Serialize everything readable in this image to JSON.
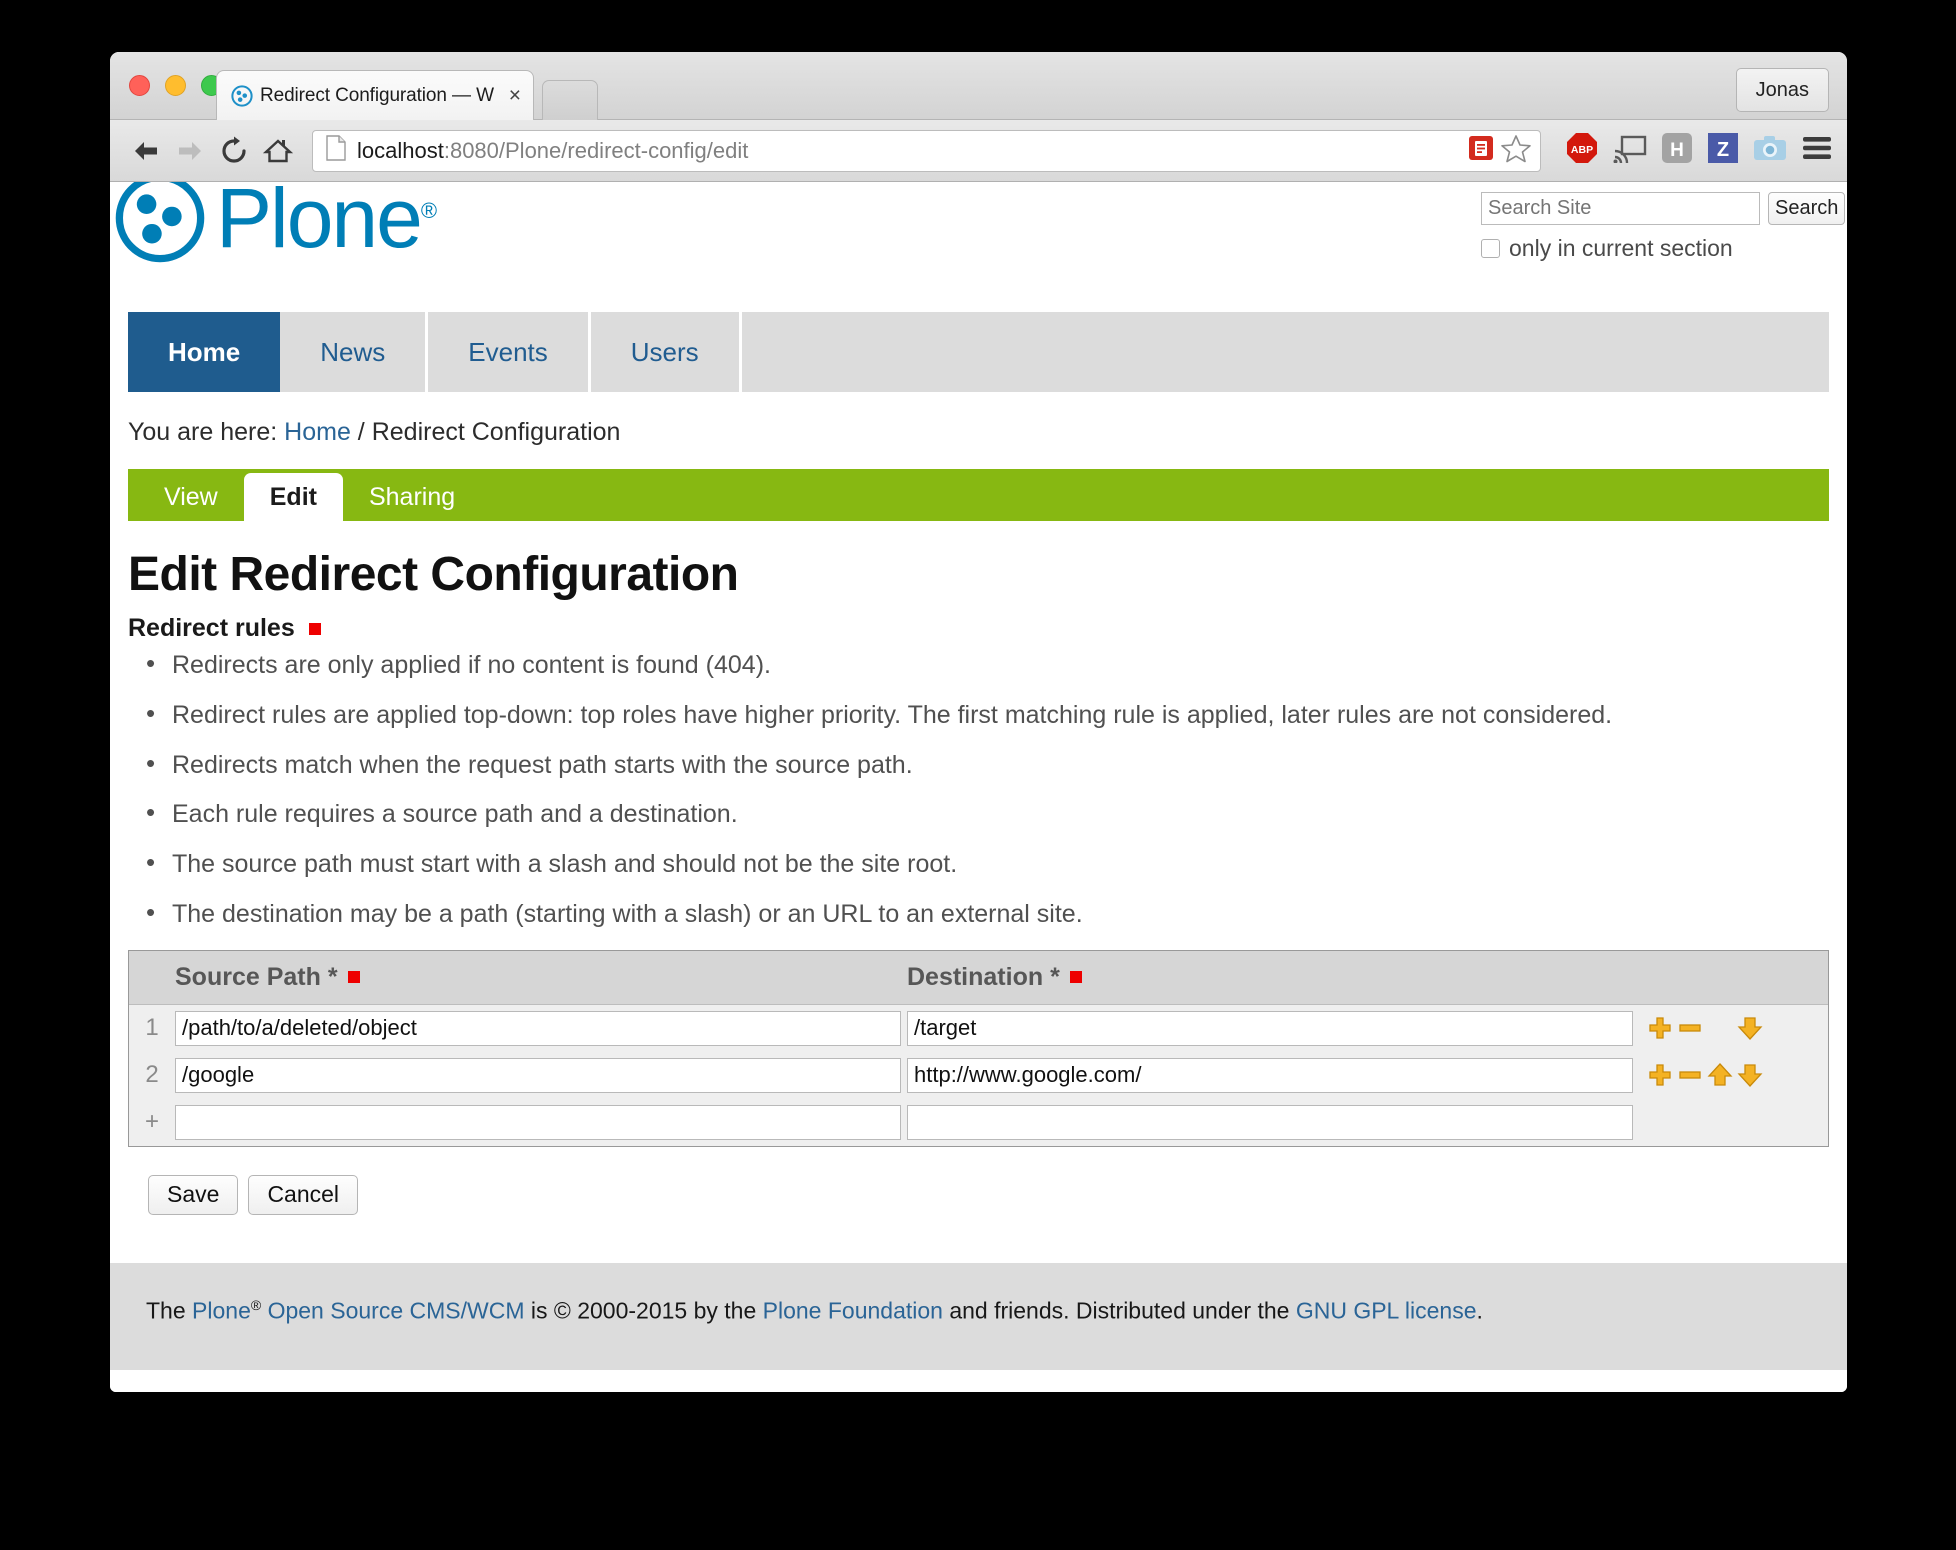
{
  "browser": {
    "tab": {
      "favicon": "plone-favicon",
      "title": "Redirect Configuration — W",
      "close_label": "×"
    },
    "profile_label": "Jonas",
    "url": {
      "host": "localhost",
      "rest": ":8080/Plone/redirect-config/edit",
      "full": "localhost:8080/Plone/redirect-config/edit"
    },
    "extensions": [
      "adblock-plus-icon",
      "cast-icon",
      "hypothesis-icon",
      "zotero-icon",
      "screenshot-camera-icon",
      "hamburger-menu-icon"
    ]
  },
  "site": {
    "logo_text": "Plone",
    "logo_reg": "®",
    "search": {
      "placeholder": "Search Site",
      "value": "",
      "button_label": "Search",
      "scope_label": "only in current section",
      "scope_checked": false
    },
    "nav": [
      {
        "label": "Home",
        "selected": true
      },
      {
        "label": "News",
        "selected": false
      },
      {
        "label": "Events",
        "selected": false
      },
      {
        "label": "Users",
        "selected": false
      }
    ],
    "breadcrumb": {
      "prefix": "You are here:",
      "home": "Home",
      "separator": "/",
      "current": "Redirect Configuration"
    },
    "content_tabs": [
      {
        "label": "View",
        "selected": false
      },
      {
        "label": "Edit",
        "selected": true
      },
      {
        "label": "Sharing",
        "selected": false
      }
    ]
  },
  "main": {
    "page_title": "Edit Redirect Configuration",
    "fieldset_label": "Redirect rules",
    "rules_help": [
      "Redirects are only applied if no content is found (404).",
      "Redirect rules are applied top-down: top roles have higher priority. The first matching rule is applied, later rules are not considered.",
      "Redirects match when the request path starts with the source path.",
      "Each rule requires a source path and a destination.",
      "The source path must start with a slash and should not be the site root.",
      "The destination may be a path (starting with a slash) or an URL to an external site."
    ],
    "datagrid": {
      "headers": [
        {
          "label": "Source Path *",
          "required": true
        },
        {
          "label": "Destination *",
          "required": true
        }
      ],
      "rows": [
        {
          "index": "1",
          "source": "/path/to/a/deleted/object",
          "destination": "/target",
          "actions": [
            "plus-icon",
            "minus-icon",
            "arrow-down-icon"
          ]
        },
        {
          "index": "2",
          "source": "/google",
          "destination": "http://www.google.com/",
          "actions": [
            "plus-icon",
            "minus-icon",
            "arrow-up-icon",
            "arrow-down-icon"
          ]
        },
        {
          "index": "+",
          "source": "",
          "destination": "",
          "actions": []
        }
      ]
    },
    "buttons": {
      "save": "Save",
      "cancel": "Cancel"
    }
  },
  "footer": {
    "t1": "The ",
    "link_plone": "Plone",
    "reg": "®",
    "link_oscms": " Open Source CMS/WCM",
    "t2": " is © 2000-2015 by the ",
    "link_foundation": "Plone Foundation",
    "t3": " and friends. Distributed under the ",
    "link_gnu": "GNU GPL license",
    "t4": "."
  },
  "colors": {
    "plone_blue": "#007EB6",
    "nav_selected": "#1F5C8E",
    "green_tabs": "#87B812",
    "required_red": "#ee0000",
    "action_gold": "#F0A818"
  }
}
